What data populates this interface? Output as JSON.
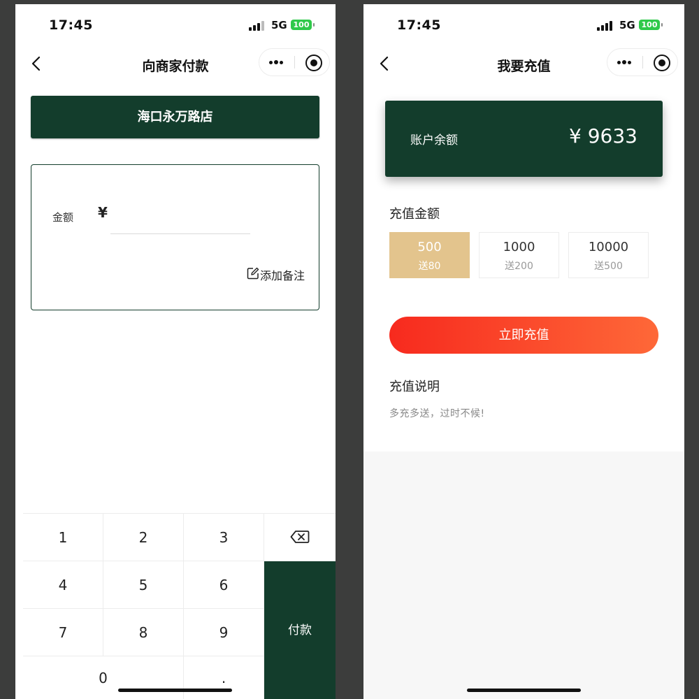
{
  "left": {
    "status_bar": {
      "time": "17:45",
      "network": "5G",
      "battery": "100"
    },
    "nav": {
      "title": "向商家付款"
    },
    "store_name": "海口永万路店",
    "amount": {
      "label": "金额",
      "currency": "¥",
      "value": ""
    },
    "add_note_label": "添加备注",
    "keypad": {
      "keys": [
        "1",
        "2",
        "3",
        "4",
        "5",
        "6",
        "7",
        "8",
        "9",
        "0",
        "."
      ],
      "pay_label": "付款"
    }
  },
  "right": {
    "status_bar": {
      "time": "17:45",
      "network": "5G",
      "battery": "100"
    },
    "nav": {
      "title": "我要充值"
    },
    "balance": {
      "label": "账户余额",
      "value": "¥ 9633"
    },
    "recharge_section_title": "充值金额",
    "options": [
      {
        "amount": "500",
        "bonus": "送80",
        "selected": true
      },
      {
        "amount": "1000",
        "bonus": "送200",
        "selected": false
      },
      {
        "amount": "10000",
        "bonus": "送500",
        "selected": false
      }
    ],
    "recharge_button_label": "立即充值",
    "description_title": "充值说明",
    "description_text": "多充多送，过时不候!"
  },
  "colors": {
    "brand_green": "#133d2c",
    "selected_option": "#e3c48d",
    "button_gradient_start": "#f72a1e",
    "button_gradient_end": "#fe6838",
    "battery_green": "#2fc94a"
  },
  "icons": [
    "signal-icon",
    "battery-icon",
    "back-icon",
    "more-icon",
    "close-mini-program-icon",
    "edit-icon",
    "backspace-icon"
  ]
}
